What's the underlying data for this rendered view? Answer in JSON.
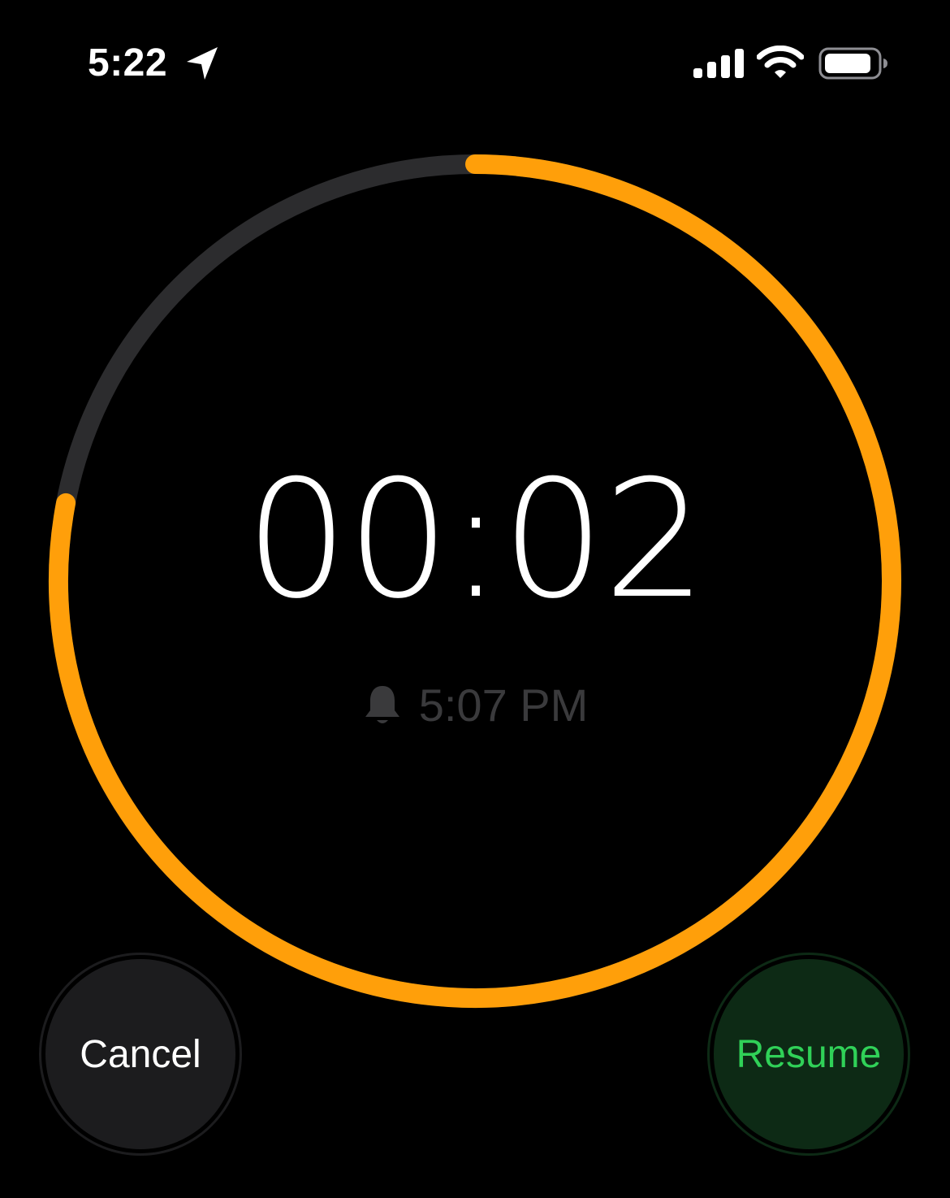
{
  "status_bar": {
    "time": "5:22",
    "location_icon": "location-arrow-icon",
    "signal_icon": "cellular-signal-icon",
    "wifi_icon": "wifi-icon",
    "battery_icon": "battery-icon"
  },
  "timer": {
    "remaining": "00:02",
    "progress_remaining_fraction": 0.78,
    "ring_track_color": "#2c2c2e",
    "ring_progress_color": "#ff9f0a"
  },
  "alarm": {
    "icon": "bell-icon",
    "end_time": "5:07 PM"
  },
  "controls": {
    "cancel_label": "Cancel",
    "resume_label": "Resume"
  }
}
